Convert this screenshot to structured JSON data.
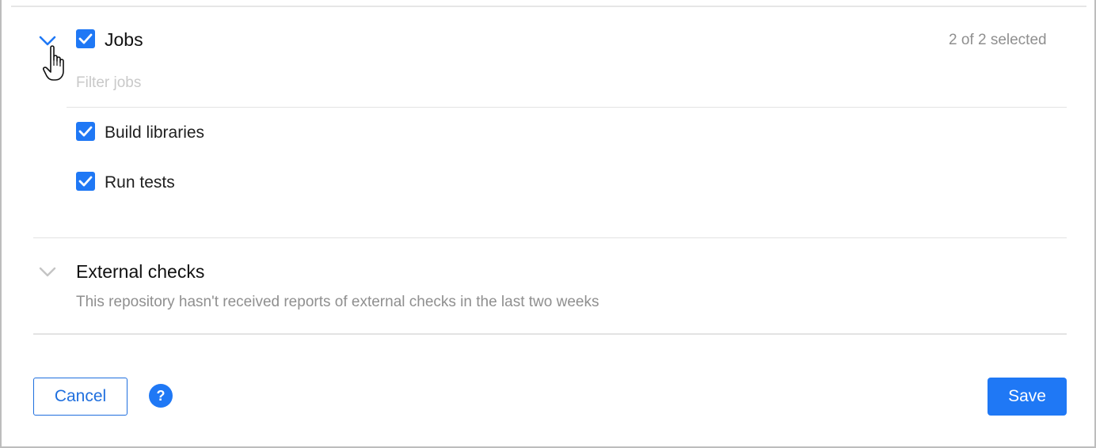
{
  "jobs_section": {
    "title": "Jobs",
    "selection_count": "2 of 2 selected",
    "checked": true,
    "filter": {
      "placeholder": "Filter jobs",
      "value": ""
    },
    "items": [
      {
        "label": "Build libraries",
        "checked": true
      },
      {
        "label": "Run tests",
        "checked": true
      }
    ]
  },
  "external_checks_section": {
    "title": "External checks",
    "description": "This repository hasn't received reports of external checks in the last two weeks"
  },
  "footer": {
    "cancel_label": "Cancel",
    "help_symbol": "?",
    "save_label": "Save"
  },
  "colors": {
    "accent": "#1f78f5",
    "muted_text": "#8f8f8f",
    "divider": "#e3e3e3"
  },
  "icons": {
    "expanded_chevron": "chevron-down-icon",
    "collapsed_chevron": "chevron-down-icon",
    "checkmark": "check-icon",
    "help": "question-circle-icon",
    "cursor": "hand-pointer-icon"
  }
}
